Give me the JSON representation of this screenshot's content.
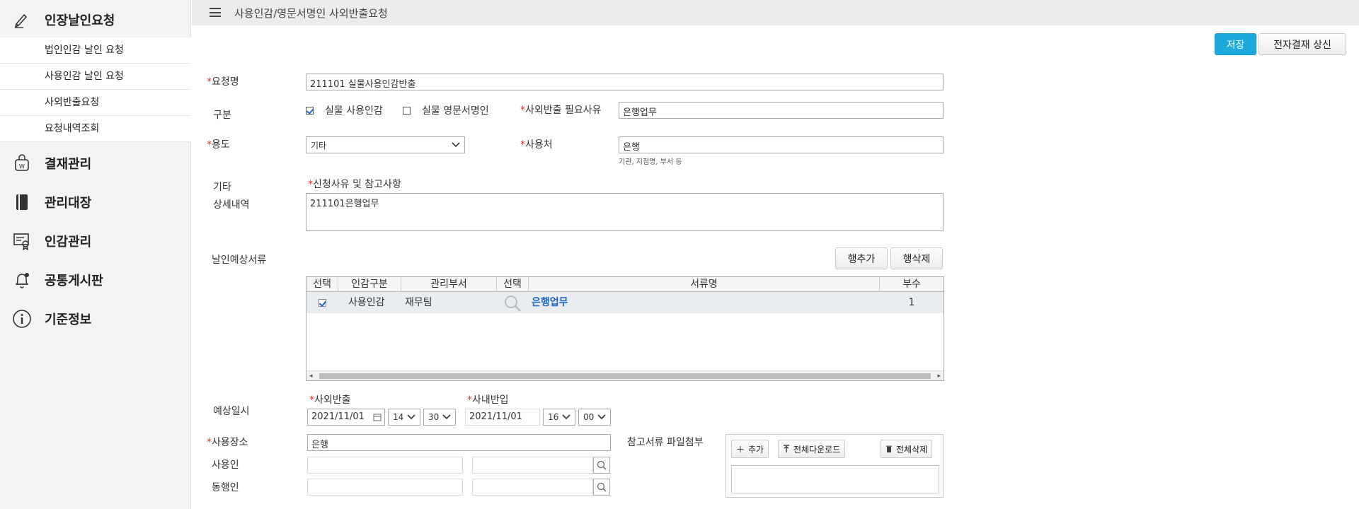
{
  "sidebar": {
    "groups": [
      {
        "label": "인장날인요청",
        "icon": "pen-icon"
      },
      {
        "label": "결재관리",
        "icon": "approval-bag-icon"
      },
      {
        "label": "관리대장",
        "icon": "book-icon"
      },
      {
        "label": "인감관리",
        "icon": "certificate-icon"
      },
      {
        "label": "공통게시판",
        "icon": "bell-icon"
      },
      {
        "label": "기준정보",
        "icon": "info-icon"
      }
    ],
    "sub_items": [
      {
        "label": "법인인감 날인 요청"
      },
      {
        "label": "사용인감 날인 요청"
      },
      {
        "label": "사외반출요청"
      },
      {
        "label": "요청내역조회"
      }
    ]
  },
  "header": {
    "title": "사용인감/영문서명인 사외반출요청"
  },
  "actions": {
    "save": "저장",
    "submit": "전자결재 상신"
  },
  "form": {
    "request_name": {
      "label": "요청명",
      "value": "211101 실물사용인감반출"
    },
    "category": {
      "label": "구분",
      "option1": "실물 사용인감",
      "option1_checked": true,
      "option2": "실물 영문서명인",
      "option2_checked": false
    },
    "export_reason": {
      "label": "사외반출 필요사유",
      "value": "은행업무"
    },
    "purpose": {
      "label": "용도",
      "value": "기타"
    },
    "usage_place": {
      "label": "사용처",
      "value": "은행",
      "hint": "기관, 지점명, 부서 등"
    },
    "etc_label1": "기타",
    "etc_label2": "상세내역",
    "reason_detail": {
      "label": "신청사유 및 참고사항",
      "value": "211101은행업무"
    },
    "documents": {
      "label": "날인예상서류",
      "add_row": "행추가",
      "delete_row": "행삭제",
      "columns": [
        "선택",
        "인감구분",
        "관리부서",
        "선택",
        "서류명",
        "부수"
      ],
      "rows": [
        {
          "checked": true,
          "seal_type": "사용인감",
          "dept": "재무팀",
          "doc_name": "은행업무",
          "copies": "1"
        }
      ]
    },
    "schedule": {
      "label": "예상일시",
      "out_label": "사외반출",
      "out_date": "2021/11/01",
      "out_hour": "14",
      "out_minute": "30",
      "in_label": "사내반입",
      "in_date": "2021/11/01",
      "in_hour": "16",
      "in_minute": "00"
    },
    "location": {
      "label": "사용장소",
      "value": "은행"
    },
    "user_label": "사용인",
    "companion_label": "동행인",
    "attachments": {
      "label": "참고서류 파일첨부",
      "add": "추가",
      "download_all": "전체다운로드",
      "delete_all": "전체삭제"
    }
  },
  "colors": {
    "primary": "#1ea9dd",
    "required": "#e53131",
    "link": "#1a66c9"
  }
}
